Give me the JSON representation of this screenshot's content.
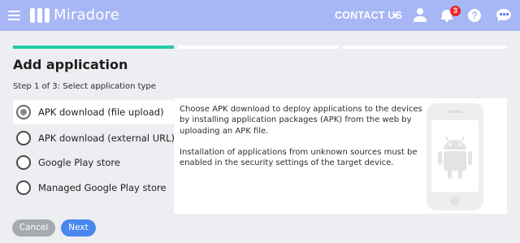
{
  "header": {
    "logo_text": "Miradore",
    "contact_label": "CONTACT US",
    "notification_count": "3",
    "help_glyph": "?",
    "icons": [
      "menu-icon",
      "miradore-logo-icon",
      "caret-down-icon",
      "user-icon",
      "bell-icon",
      "help-icon",
      "chat-icon"
    ],
    "background_color": "#a7b6f4"
  },
  "wizard": {
    "title": "Add application",
    "step_label": "Step 1 of 3: Select application type",
    "progress": {
      "current_step": 1,
      "total_steps": 3,
      "active_color": "#22c9a4"
    },
    "options": [
      {
        "label": "APK download (file upload)",
        "selected": true
      },
      {
        "label": "APK download (external URL)",
        "selected": false
      },
      {
        "label": "Google Play store",
        "selected": false
      },
      {
        "label": "Managed Google Play store",
        "selected": false
      }
    ],
    "description": {
      "paragraph1": "Choose APK download to deploy applications to the devices by installing application packages (APK) from the web by uploading an APK file.",
      "paragraph2": "Installation of applications from unknown sources must be enabled in the security settings of the target device.",
      "illustration": "android-phone-icon"
    },
    "buttons": {
      "cancel_label": "Cancel",
      "next_label": "Next"
    }
  }
}
